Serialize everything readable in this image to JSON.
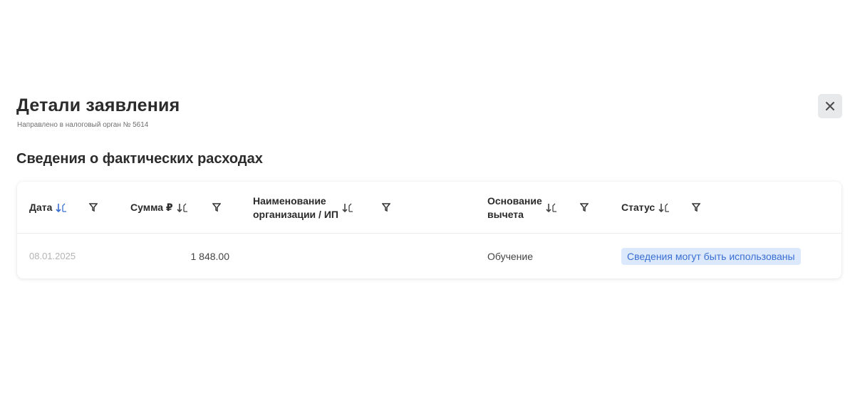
{
  "modal": {
    "title": "Детали заявления",
    "subtitle": "Направлено в налоговый орган № 5614",
    "close_icon": "close-icon"
  },
  "section": {
    "title": "Сведения о фактических расходах"
  },
  "table": {
    "columns": {
      "date": "Дата",
      "amount": "Сумма ₽",
      "org_line1": "Наименование",
      "org_line2": "организации / ИП",
      "basis_line1": "Основание",
      "basis_line2": "вычета",
      "status": "Статус"
    },
    "sort_icon": "sort-icon",
    "filter_icon": "filter-icon",
    "rows": [
      {
        "date": "08.01.2025",
        "amount": "1 848.00",
        "org": "",
        "basis": "Обучение",
        "status": "Сведения могут быть использованы"
      }
    ]
  },
  "colors": {
    "accent": "#3a6fd2",
    "badge_bg": "#dce8fb",
    "text": "#2b2b2b",
    "muted": "#b4b4b4"
  }
}
